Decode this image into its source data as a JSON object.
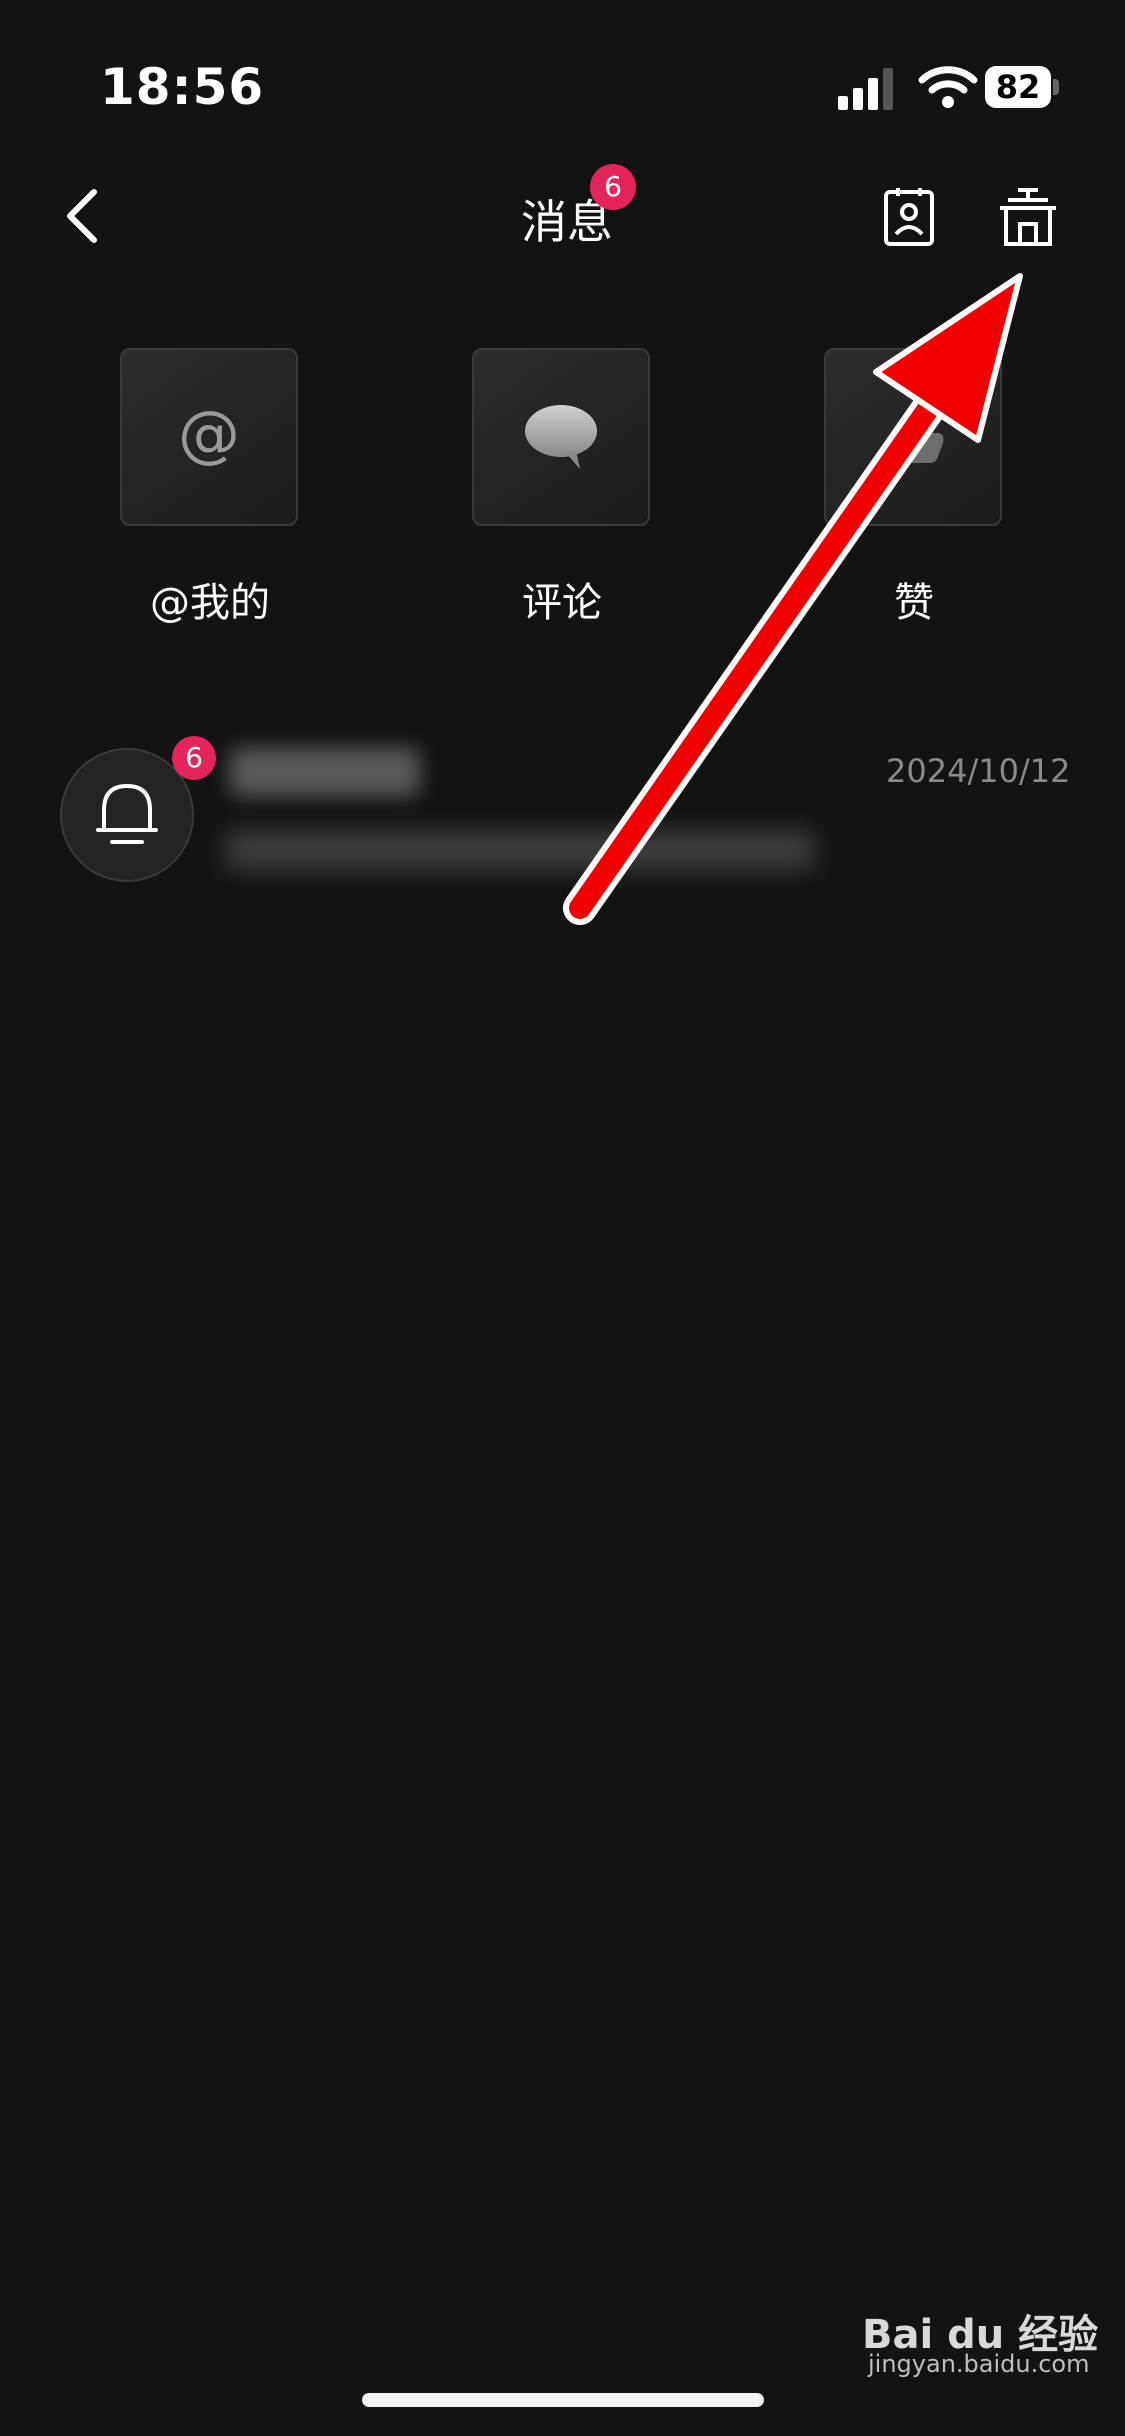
{
  "status_bar": {
    "time": "18:56",
    "battery": "82"
  },
  "header": {
    "title": "消息",
    "title_badge": "6"
  },
  "tiles": [
    {
      "label": "@我的",
      "icon": "at-icon"
    },
    {
      "label": "评论",
      "icon": "comment-bubble-icon"
    },
    {
      "label": "赞",
      "icon": "like-icon"
    }
  ],
  "notifications": [
    {
      "icon": "bell-icon",
      "badge": "6",
      "date": "2024/10/12"
    }
  ],
  "annotation": {
    "color": "#ff0000"
  },
  "watermark": {
    "brand": "Bai du 经验",
    "url": "jingyan.baidu.com"
  },
  "colors": {
    "background": "#131313",
    "badge": "#e5245b"
  }
}
